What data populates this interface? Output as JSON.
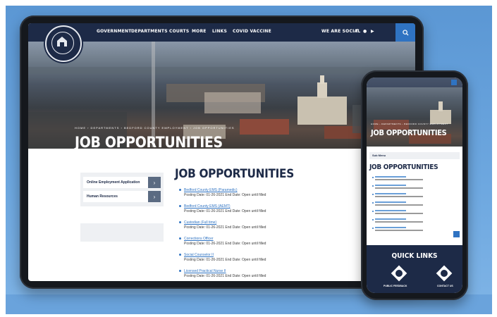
{
  "nav": {
    "items": [
      "GOVERNMENT",
      "DEPARTMENTS",
      "COURTS",
      "MORE",
      "LINKS",
      "COVID VACCINE"
    ],
    "social_label": "WE ARE SOCIAL"
  },
  "seal": {
    "text": "BEDFORD COUNTY TENNESSEE 1807"
  },
  "hero": {
    "breadcrumb": "HOME › DEPARTMENTS › BEDFORD COUNTY EMPLOYMENT › JOB OPPORTUNITIES",
    "title": "JOB OPPORTUNITIES"
  },
  "sidebar": {
    "links": [
      {
        "label": "Online Employment Application"
      },
      {
        "label": "Human Resources"
      }
    ]
  },
  "content": {
    "title": "JOB OPPORTUNITIES",
    "jobs": [
      {
        "title": "Bedford County EMS (Paramedic)",
        "meta": "Posting Date: 01-26-2021    End Date: Open until filled"
      },
      {
        "title": "Bedford County EMS (AEMT)",
        "meta": "Posting Date: 01-26-2021    End Date: Open until filled"
      },
      {
        "title": "Custodian (Full time)",
        "meta": "Posting Date: 01-26-2021    End Date: Open until filled"
      },
      {
        "title": "Corrections Officer",
        "meta": "Posting Date: 01-26-2021    End Date: Open until filled"
      },
      {
        "title": "Social Counselor II",
        "meta": "Posting Date: 01-26-2021    End Date: Open until filled"
      },
      {
        "title": "Licensed Practical Nurse II",
        "meta": "Posting Date: 01-26-2021    End Date: Open until filled"
      }
    ]
  },
  "phone": {
    "breadcrumb": "HOME › DEPARTMENTS › BEDFORD COUNTY EMPLOYMENT",
    "hero_title": "JOB OPPORTUNITIES",
    "submenu_label": "Sub Menu",
    "content_title": "JOB OPPORTUNITIES",
    "quick_links_title": "QUICK LINKS",
    "quick_links": [
      "PUBLIC FEEDBACK",
      "CONTACT US"
    ]
  },
  "colors": {
    "navy": "#1d2a47",
    "accent": "#2f73c2",
    "background": "#6aa3dc"
  }
}
